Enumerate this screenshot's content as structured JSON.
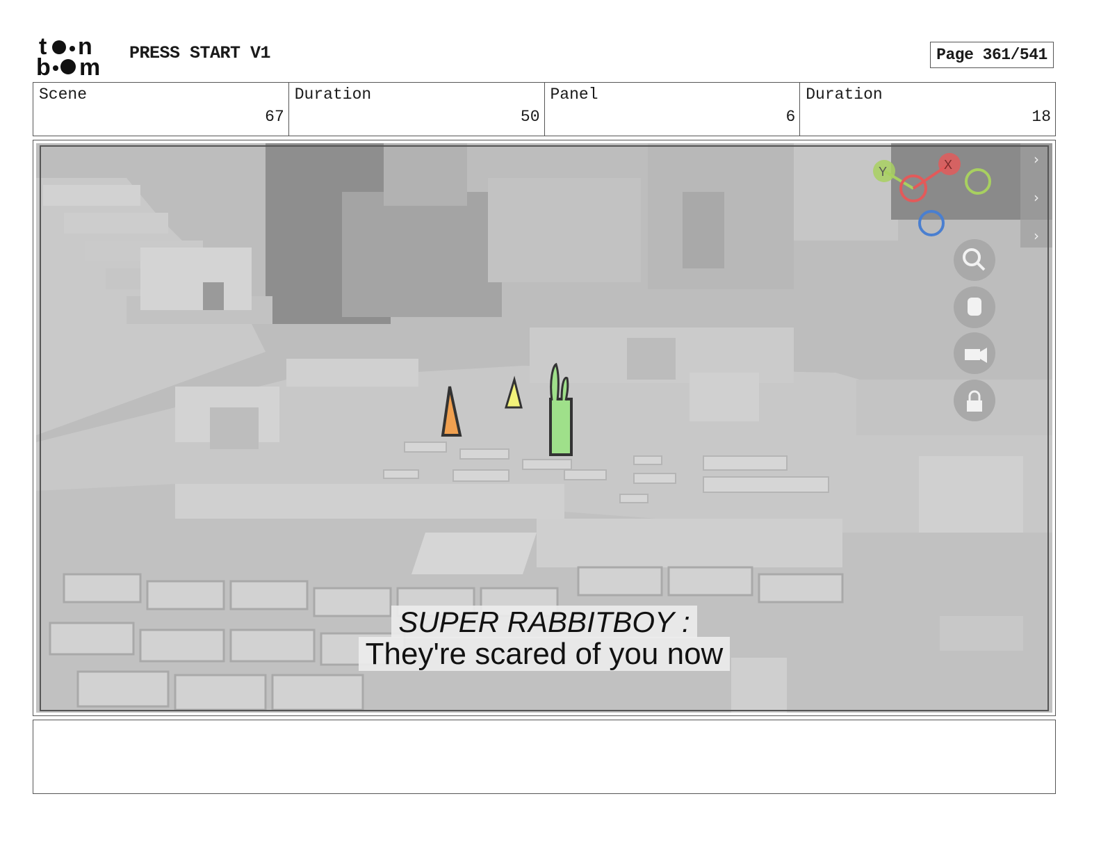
{
  "header": {
    "logo_text": "toon boom",
    "project_title": "PRESS START V1",
    "page_label": "Page 361/541"
  },
  "info": [
    {
      "label": "Scene",
      "value": "67"
    },
    {
      "label": "Duration",
      "value": "50"
    },
    {
      "label": "Panel",
      "value": "6"
    },
    {
      "label": "Duration",
      "value": "18"
    }
  ],
  "panel": {
    "dialogue_speaker": "SUPER RABBITBOY :",
    "dialogue_line": "They're scared of you now",
    "gizmo_axes": [
      "Y",
      "X"
    ],
    "viewport_tools": [
      "zoom-icon",
      "hand-icon",
      "camera-icon",
      "lock-icon"
    ],
    "colors": {
      "axis_y": "#a8d060",
      "axis_x": "#e25a5a",
      "axis_blue": "#4a7fd0",
      "character_orange": "#f0a050",
      "character_yellow": "#f2f27a",
      "character_green": "#9fe08a"
    }
  },
  "notes": ""
}
